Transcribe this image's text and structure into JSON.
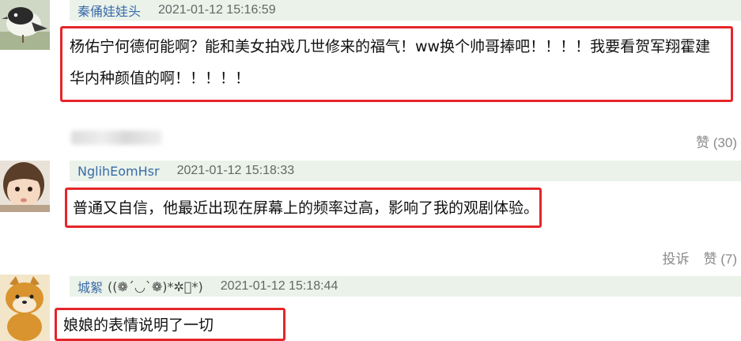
{
  "comments": [
    {
      "username": "秦俑娃娃头",
      "username_tail": "",
      "timestamp": "2021-01-12 15:16:59",
      "text_line1": "杨佑宁何德何能啊？能和美女拍戏几世修来的福气！ww换个帅哥捧吧！！！！我要看贺军翔霍建",
      "text_line2": "华内种颜值的啊！！！！！",
      "like": "赞 (30)"
    },
    {
      "username": "NglihEomHsr",
      "username_tail": "",
      "timestamp": "2021-01-12 15:18:33",
      "text_line1": "普通又自信，他最近出现在屏幕上的频率过高，影响了我的观剧体验。",
      "report": "投诉",
      "like": "赞 (7)"
    },
    {
      "username": "城絮",
      "username_tail": "((❁´◡`❁)*✲ﾟ*)",
      "timestamp": "2021-01-12 15:18:44",
      "text_line1": "娘娘的表情说明了一切"
    }
  ],
  "colors": {
    "header_bg": "#eaf2ea",
    "username": "#3a6aa8",
    "highlight_border": "#e4262a"
  },
  "icons": [
    "bird-avatar-icon",
    "baby-avatar-icon",
    "shiba-dog-avatar-icon"
  ]
}
